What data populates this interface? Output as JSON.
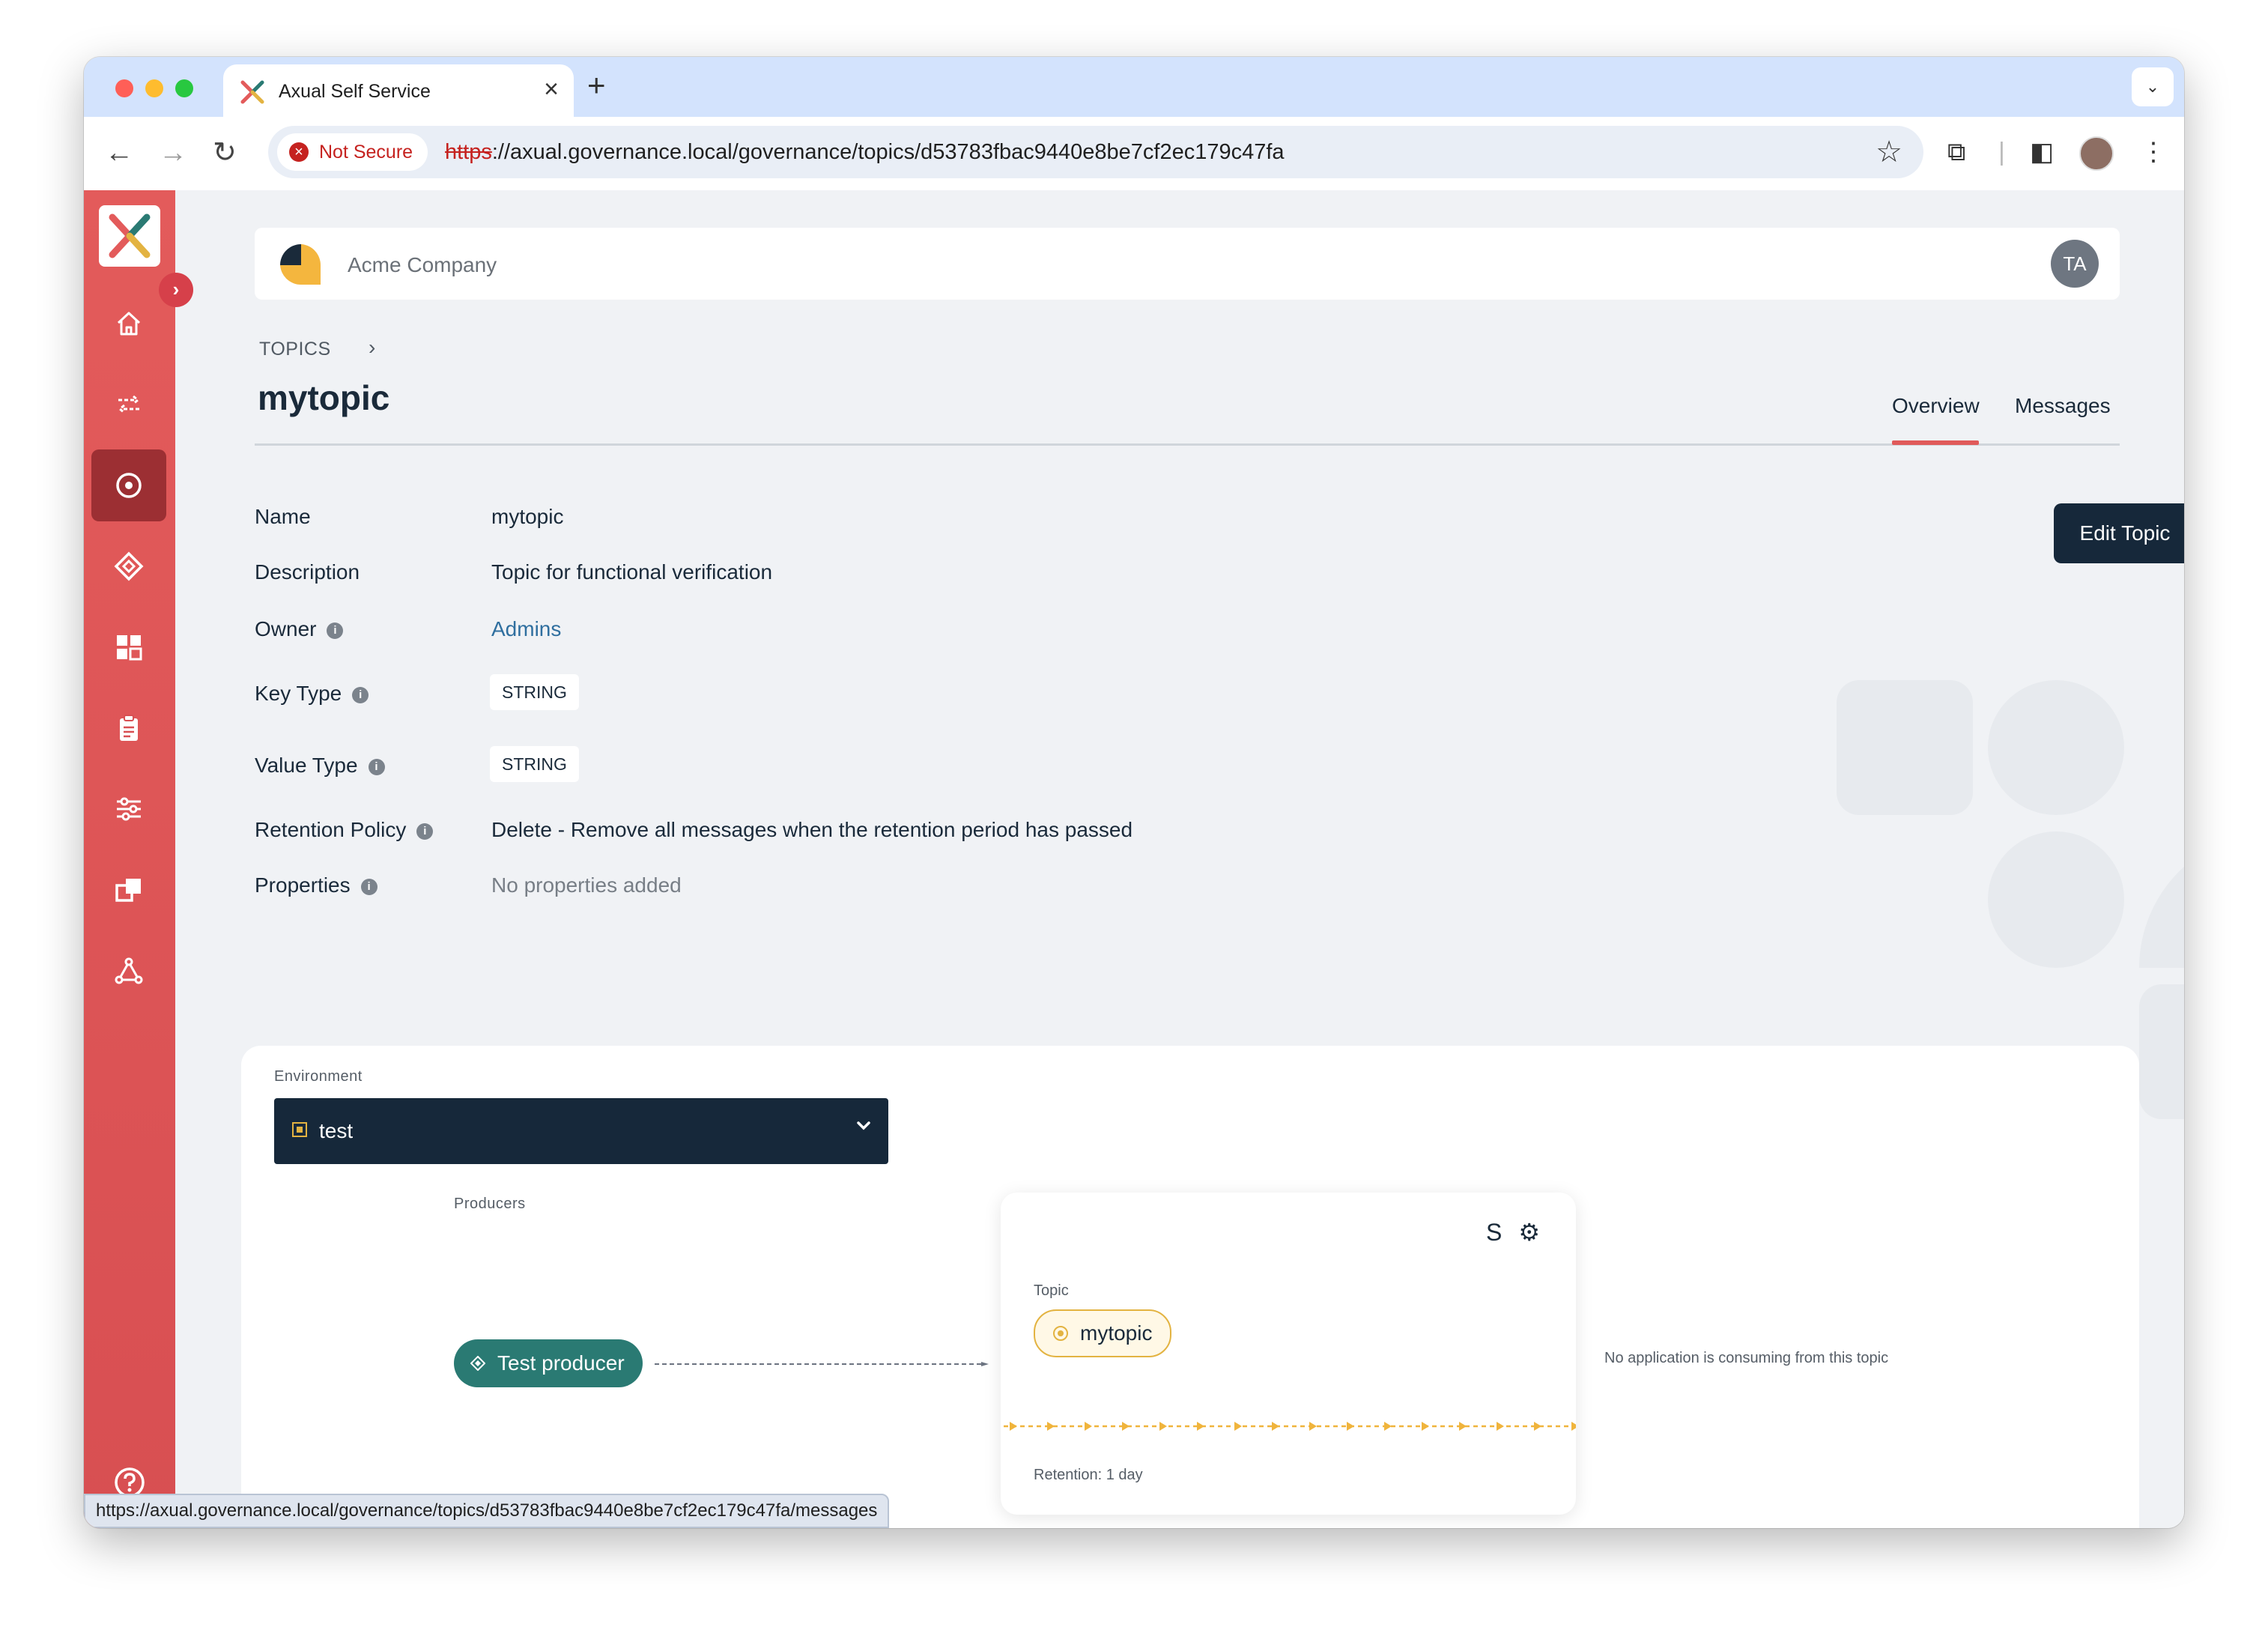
{
  "browser": {
    "tab_title": "Axual Self Service",
    "tab_close": "×",
    "new_tab": "+",
    "not_secure": "Not Secure",
    "url_scheme": "https",
    "url_rest": "://axual.governance.local/governance/topics/d53783fbac9440e8be7cf2ec179c47fa",
    "status_url": "https://axual.governance.local/governance/topics/d53783fbac9440e8be7cf2ec179c47fa/messages"
  },
  "header": {
    "org_name": "Acme Company",
    "user_initials": "TA"
  },
  "sidebar": {
    "items": [
      {
        "name": "home-icon",
        "active": false
      },
      {
        "name": "streams-icon",
        "active": false
      },
      {
        "name": "topics-icon",
        "active": true
      },
      {
        "name": "applications-icon",
        "active": false
      },
      {
        "name": "dashboard-icon",
        "active": false
      },
      {
        "name": "clipboard-icon",
        "active": false
      },
      {
        "name": "settings-sliders-icon",
        "active": false
      },
      {
        "name": "instances-icon",
        "active": false
      },
      {
        "name": "network-icon",
        "active": false
      }
    ],
    "help_icon": "help-icon"
  },
  "breadcrumb": {
    "label": "TOPICS"
  },
  "page": {
    "title": "mytopic",
    "tabs": [
      "Overview",
      "Messages"
    ],
    "active_tab": "Overview",
    "edit_button": "Edit Topic"
  },
  "details": {
    "name_label": "Name",
    "name_value": "mytopic",
    "description_label": "Description",
    "description_value": "Topic for functional verification",
    "owner_label": "Owner",
    "owner_value": "Admins",
    "key_type_label": "Key Type",
    "key_type_value": "STRING",
    "value_type_label": "Value Type",
    "value_type_value": "STRING",
    "retention_label": "Retention Policy",
    "retention_value": "Delete - Remove all messages when the retention period has passed",
    "properties_label": "Properties",
    "properties_value": "No properties added"
  },
  "graph": {
    "environment_label": "Environment",
    "environment_value": "test",
    "producers_label": "Producers",
    "producer_name": "Test producer",
    "topic_label": "Topic",
    "topic_name": "mytopic",
    "retention": "Retention: 1 day",
    "no_consumer": "No application is consuming from this topic",
    "schema_icon_glyph": "S"
  },
  "colors": {
    "sidebar": "#e35b5b",
    "active_nav": "#9c2f33",
    "primary_dark": "#16283a",
    "producer": "#2a7a73",
    "topic_accent": "#e3b341",
    "tab_underline": "#e05a5a",
    "link": "#2f6f9f"
  }
}
